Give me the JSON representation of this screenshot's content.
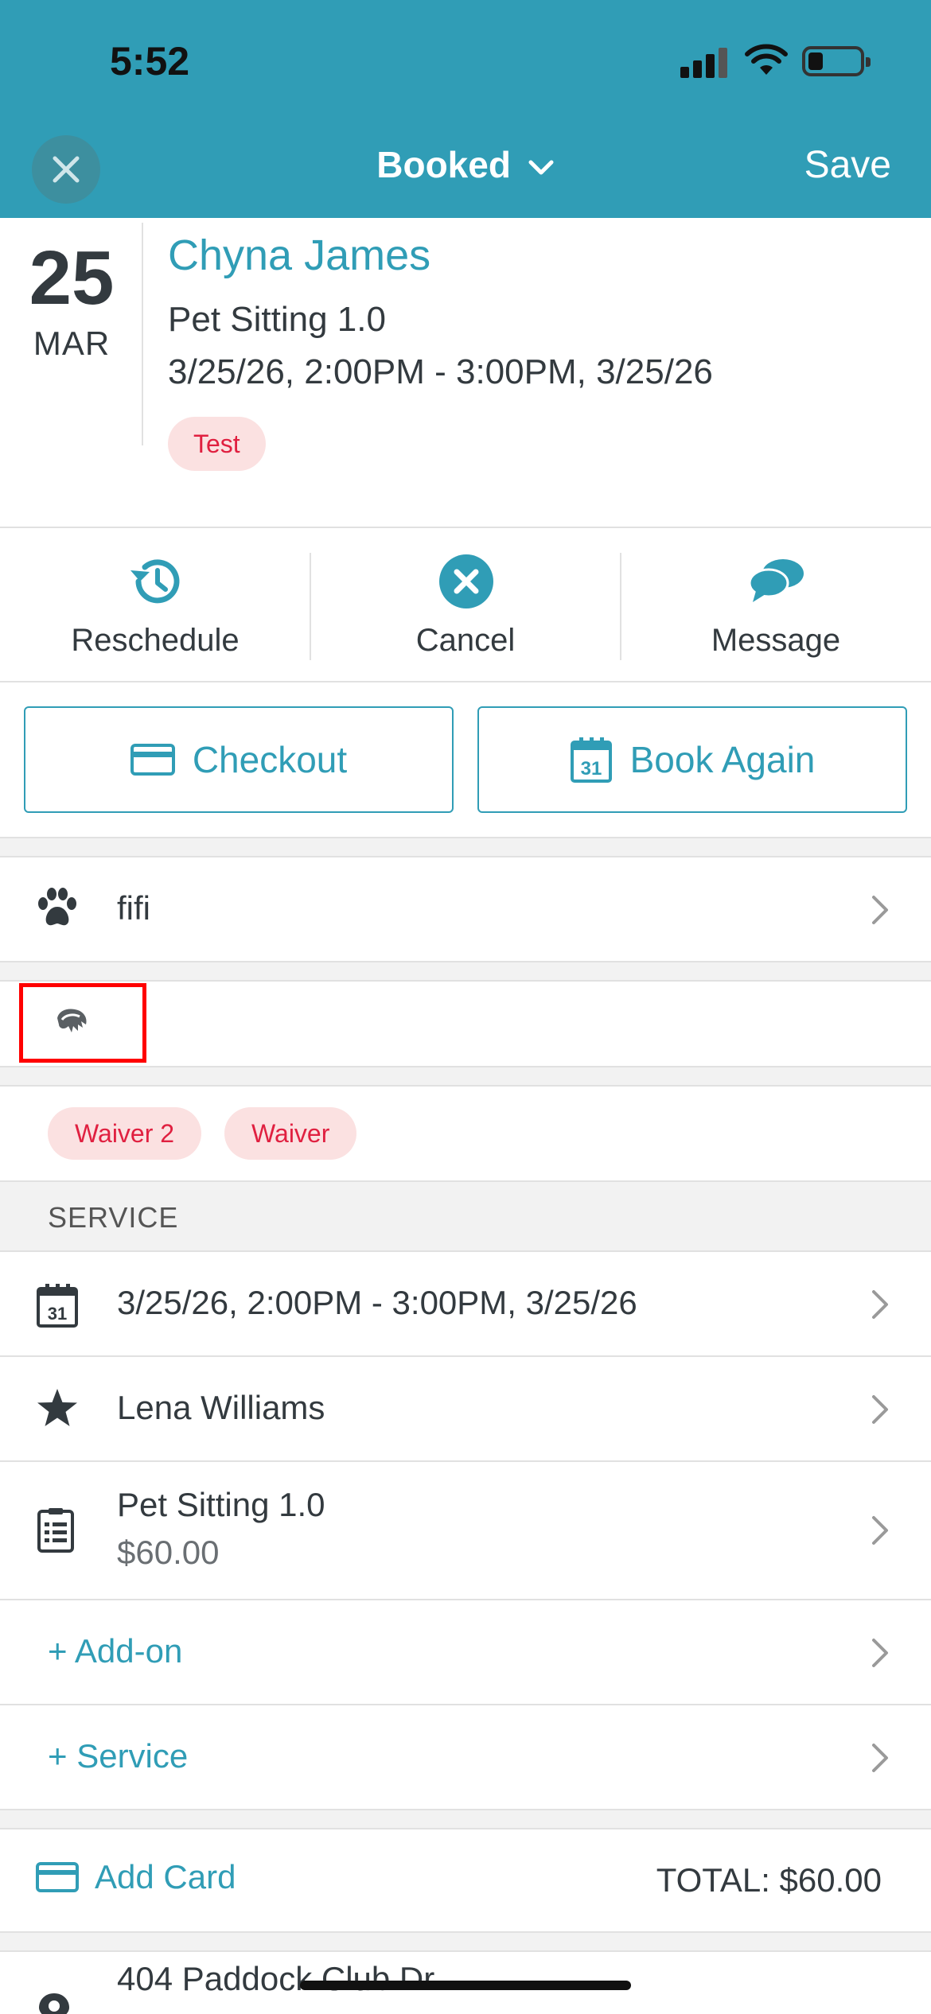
{
  "status_bar": {
    "time": "5:52"
  },
  "nav": {
    "title": "Booked",
    "save_label": "Save"
  },
  "appointment": {
    "day": "25",
    "month": "MAR",
    "client_name": "Chyna James",
    "service": "Pet Sitting 1.0",
    "time_range": "3/25/26, 2:00PM - 3:00PM, 3/25/26",
    "tag": "Test"
  },
  "actions": [
    {
      "label": "Reschedule",
      "icon": "history-icon"
    },
    {
      "label": "Cancel",
      "icon": "cancel-circle-icon"
    },
    {
      "label": "Message",
      "icon": "chat-bubbles-icon"
    }
  ],
  "buttons": {
    "checkout": "Checkout",
    "book_again": "Book Again",
    "book_again_calendar_day": "31"
  },
  "pet": {
    "name": "fifi"
  },
  "waivers": [
    "Waiver 2",
    "Waiver"
  ],
  "service_section": {
    "header": "SERVICE",
    "date_row": "3/25/26, 2:00PM - 3:00PM, 3/25/26",
    "calendar_day": "31",
    "staff": "Lena Williams",
    "service_name": "Pet Sitting 1.0",
    "service_price": "$60.00",
    "add_on": "+ Add-on",
    "add_service": "+ Service"
  },
  "payment": {
    "add_card": "Add Card",
    "total": "TOTAL: $60.00"
  },
  "address": {
    "line1": "404 Paddock Club Dr"
  },
  "colors": {
    "accent": "#309db6",
    "tag_bg": "#fbe1e1",
    "tag_text": "#e02040"
  }
}
